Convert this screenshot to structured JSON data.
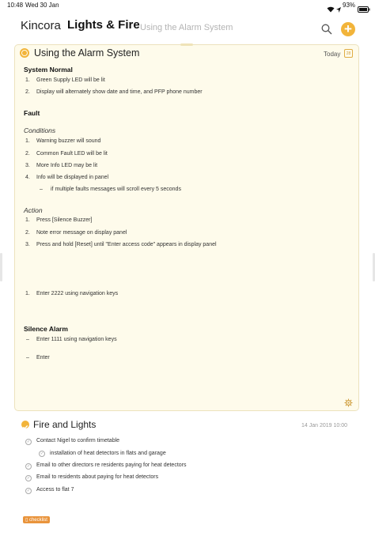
{
  "status": {
    "time": "10:48",
    "date": "Wed 30 Jan",
    "battery": "93%"
  },
  "header": {
    "brand": "Kincora",
    "project": "Lights & Fire",
    "subtitle": "Using the Alarm System",
    "add_label": "+"
  },
  "note": {
    "title": "Using the Alarm System",
    "date_label": "Today",
    "calendar_icon_text": "28",
    "system_normal": {
      "heading": "System Normal",
      "items": [
        "Green Supply LED will be lit",
        "Display will alternately show date and time, and PFP phone number"
      ]
    },
    "fault": {
      "heading": "Fault"
    },
    "conditions": {
      "heading": "Conditions",
      "items": [
        "Warning buzzer will sound",
        "Common Fault LED will be lit",
        "More Info LED may be lit",
        "Info will be displayed in panel"
      ],
      "subitem": "if multiple faults messages will scroll every 5 seconds"
    },
    "action": {
      "heading": "Action",
      "items": [
        "Press [Silence Buzzer]",
        "Note error message on display panel",
        "Press and hold [Reset] until \"Enter access code\" appears in display panel"
      ],
      "extra_item": "Enter 2222 using navigation keys"
    },
    "silence": {
      "heading": "Silence Alarm",
      "items": [
        "Enter 1111 using navigation keys",
        "Enter"
      ]
    }
  },
  "note2": {
    "title": "Fire and Lights",
    "date": "14 Jan 2019  10:00",
    "items": [
      "Contact Nigel to confirm timetable",
      "installation of heat detectors in flats and garage",
      "Email to other directors re residents paying for heat detectors",
      "Email to residents about paying for heat detectors",
      "Access to flat 7"
    ],
    "tag": "checklist"
  },
  "numbers": {
    "n1": "1.",
    "n2": "2.",
    "n3": "3.",
    "n4": "4.",
    "dash": "–"
  },
  "colors": {
    "accent": "#f2b43a",
    "card_bg": "#fefbeb",
    "tag": "#e9943c"
  }
}
